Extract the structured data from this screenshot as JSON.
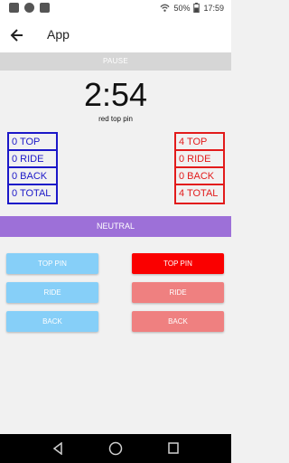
{
  "status_bar": {
    "battery": "50%",
    "time": "17:59"
  },
  "app_bar": {
    "title": "App"
  },
  "pause_label": "PAUSE",
  "timer": {
    "value": "2:54",
    "status": "red top pin"
  },
  "blue_scores": [
    "0 TOP",
    "0 RIDE",
    "0 BACK",
    "0 TOTAL"
  ],
  "red_scores": [
    "4 TOP",
    "0 RIDE",
    "0 BACK",
    "4 TOTAL"
  ],
  "neutral_label": "NEUTRAL",
  "blue_buttons": [
    "TOP PIN",
    "RIDE",
    "BACK"
  ],
  "red_buttons": [
    "TOP PIN",
    "RIDE",
    "BACK"
  ],
  "colors": {
    "blue": "#1b17c8",
    "red": "#e21b1b",
    "neutral": "#9d70d8",
    "light_blue": "#86cff8",
    "pink": "#ef8080"
  }
}
